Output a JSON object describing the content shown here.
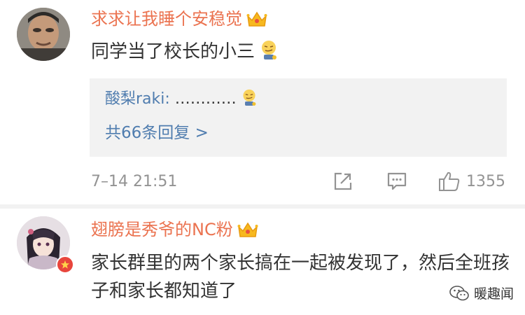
{
  "comments": [
    {
      "username": "求求让我睡个安稳觉",
      "text": "同学当了校长的小三",
      "text_emoji": "smirk-emoji",
      "reply": {
        "user": "酸梨raki:",
        "text": " …………",
        "text_emoji": "smirk-emoji",
        "more": "共66条回复 >"
      },
      "timestamp": "7–14 21:51",
      "likes": "1355"
    },
    {
      "username": "翅膀是秀爷的NC粉",
      "text": "家长群里的两个家长搞在一起被发现了，然后全班孩子和家长都知道了"
    }
  ],
  "watermark": "暖趣闻",
  "colors": {
    "username": "#eb7350",
    "link": "#507daf",
    "meta": "#939393",
    "reply_bg": "#f2f2f2"
  }
}
